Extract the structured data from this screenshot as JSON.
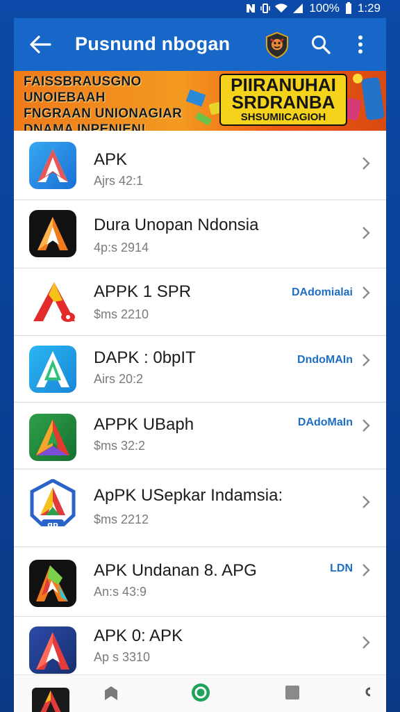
{
  "status_bar": {
    "time": "1:29",
    "battery": "100%",
    "icons": [
      "nfc-icon",
      "vibrate-icon",
      "wifi-icon",
      "signal-icon",
      "battery-icon"
    ]
  },
  "app_bar": {
    "title": "Pusnund nbogan",
    "icons": [
      "back-arrow-icon",
      "badge-avatar-icon",
      "search-icon",
      "more-vert-icon"
    ]
  },
  "banner": {
    "left_lines": [
      "FAISSBRAUSGNO UNOIEBAAH",
      "FNGRAAN UNIONAGIAR",
      "DNAMA INPENIEN!"
    ],
    "right_lines": [
      "PIIRANUHAI",
      "SRDRANBA"
    ],
    "right_small": "SHSUMIICAGIOH"
  },
  "apps": [
    {
      "name": "APK",
      "meta": "Ajrs 42:1",
      "action": "",
      "icon": "apk-blue-icon"
    },
    {
      "name": "Dura Unopan Ndonsia",
      "meta": "4p:s 2914",
      "action": "",
      "icon": "apk-dark-orange-icon"
    },
    {
      "name": "APPK 1 SPR",
      "meta": "$ms 2210",
      "action": "DAdomialai",
      "icon": "apk-red-yellow-icon"
    },
    {
      "name": "DAPK : 0bpIT",
      "meta": "Airs 20:2",
      "action": "DndoMAIn",
      "icon": "apk-cyan-green-icon"
    },
    {
      "name": "APPK UBaph",
      "meta": "$ms 32:2",
      "action": "DAdoMaIn",
      "icon": "apk-green-icon"
    },
    {
      "name": "ApPK USepkar Indamsia:",
      "meta": "$ms 2212",
      "action": "",
      "icon": "apk-shield-icon"
    },
    {
      "name": "APK Undanan  8. APG",
      "meta": "An:s 43:9",
      "action": "LDN",
      "icon": "apk-black-multicolor-icon"
    },
    {
      "name": "APK 0: APK",
      "meta": "Ap s 3310",
      "action": "",
      "icon": "apk-navy-red-icon"
    }
  ],
  "bottom_nav": [
    "app-icon",
    "bookmark-icon",
    "home-circle-icon",
    "square-icon",
    "settings-icon"
  ],
  "colors": {
    "accent": "#1767c8",
    "background": "#0b4aa8",
    "action_text": "#1f6ec2",
    "banner_orange": "#f07a1a",
    "banner_yellow": "#f5d21c"
  }
}
